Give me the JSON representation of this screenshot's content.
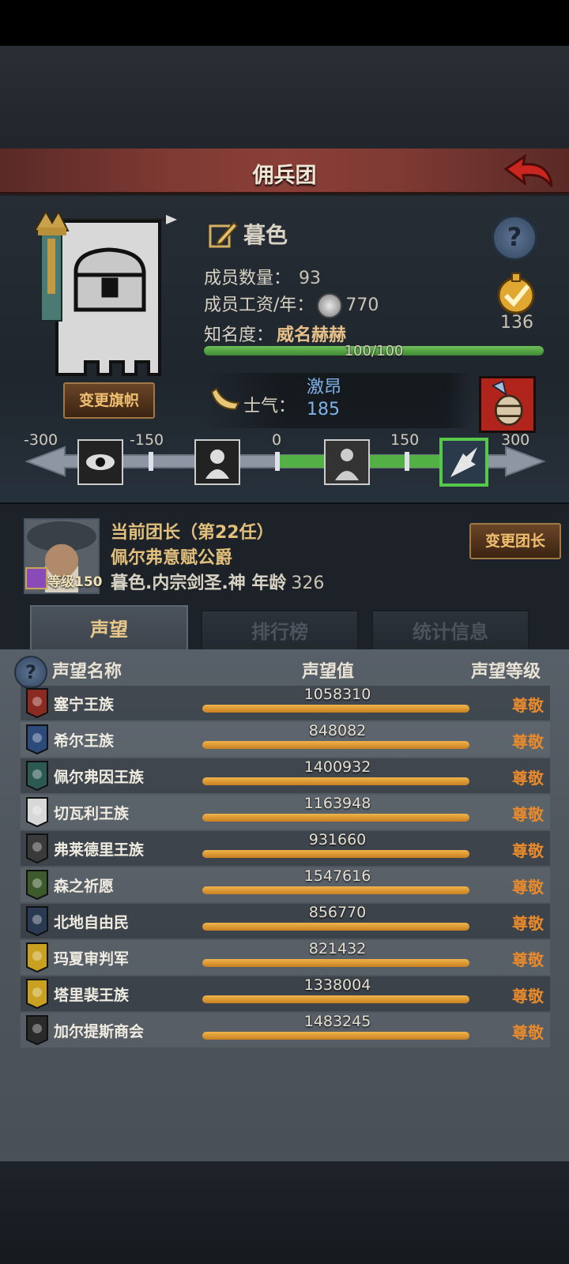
{
  "header": {
    "title": "佣兵团"
  },
  "banner": {
    "change_flag_label": "变更旗帜"
  },
  "company": {
    "name": "暮色",
    "members_label": "成员数量：",
    "members_value": "93",
    "wage_label": "成员工资/年：",
    "wage_value": "770",
    "fame_label": "知名度：",
    "fame_value": "威名赫赫",
    "fame_progress_text": "100/100",
    "fame_progress": 1.0,
    "task_count": "136"
  },
  "morale": {
    "label": "士气：",
    "state": "激昂",
    "value": "185",
    "scale_labels": [
      "-300",
      "-150",
      "0",
      "150",
      "300"
    ]
  },
  "leader": {
    "title": "当前团长（第22任）",
    "name": "佩尔弗意赋公爵",
    "level_text": "等级150",
    "desc": "暮色.内宗剑圣.神",
    "age_label": "年龄",
    "age_value": "326",
    "change_leader_label": "变更团长"
  },
  "tabs": [
    {
      "label": "声望",
      "active": true
    },
    {
      "label": "排行榜",
      "active": false
    },
    {
      "label": "统计信息",
      "active": false
    }
  ],
  "reputation": {
    "col_name": "声望名称",
    "col_value": "声望值",
    "col_level": "声望等级",
    "rows": [
      {
        "name": "塞宁王族",
        "value": "1058310",
        "level": "尊敬",
        "color": "#8a2a22"
      },
      {
        "name": "希尔王族",
        "value": "848082",
        "level": "尊敬",
        "color": "#2c4a7a"
      },
      {
        "name": "佩尔弗因王族",
        "value": "1400932",
        "level": "尊敬",
        "color": "#2c5a52"
      },
      {
        "name": "切瓦利王族",
        "value": "1163948",
        "level": "尊敬",
        "color": "#d8d8d8"
      },
      {
        "name": "弗莱德里王族",
        "value": "931660",
        "level": "尊敬",
        "color": "#3a3a3a"
      },
      {
        "name": "森之祈愿",
        "value": "1547616",
        "level": "尊敬",
        "color": "#3c5a2c"
      },
      {
        "name": "北地自由民",
        "value": "856770",
        "level": "尊敬",
        "color": "#2a3a52"
      },
      {
        "name": "玛夏审判军",
        "value": "821432",
        "level": "尊敬",
        "color": "#c9a020"
      },
      {
        "name": "塔里裴王族",
        "value": "1338004",
        "level": "尊敬",
        "color": "#c9a020"
      },
      {
        "name": "加尔提斯商会",
        "value": "1483245",
        "level": "尊敬",
        "color": "#2a2a2a"
      }
    ]
  }
}
